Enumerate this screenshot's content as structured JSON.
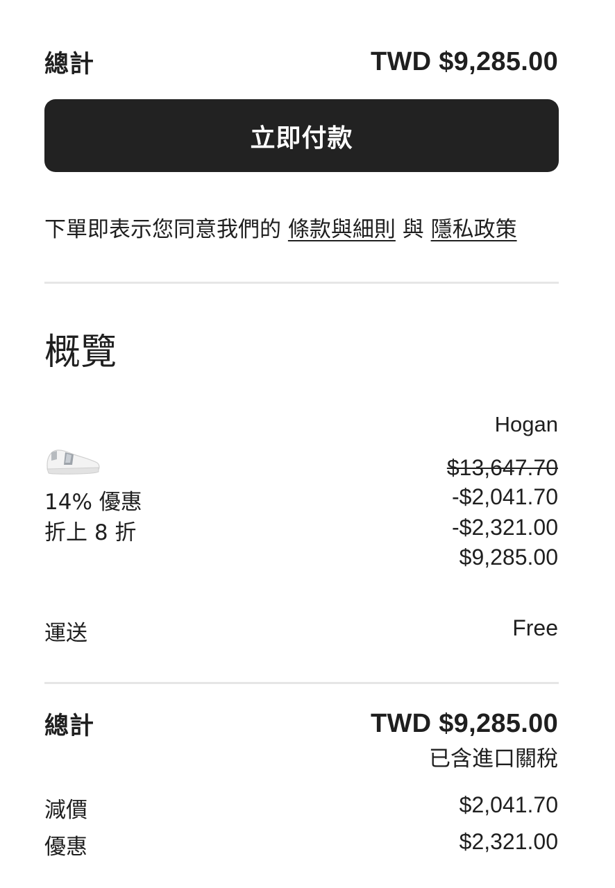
{
  "summary_top": {
    "label": "總計",
    "amount": "TWD $9,285.00"
  },
  "pay_button": {
    "label": "立即付款"
  },
  "consent": {
    "prefix": "下單即表示您同意我們的",
    "terms_link": "條款與細則",
    "joiner": "與",
    "privacy_link": "隱私政策"
  },
  "overview": {
    "title": "概覽",
    "product": {
      "brand": "Hogan",
      "image_icon": "sneaker-thumbnail",
      "original_price": "$13,647.70",
      "discount_label": "14% 優惠",
      "discount_amount": "-$2,041.70",
      "extra_discount_label": "折上 8 折",
      "extra_discount_amount": "-$2,321.00",
      "final_price": "$9,285.00"
    },
    "shipping": {
      "label": "運送",
      "value": "Free"
    }
  },
  "totals": {
    "label": "總計",
    "amount": "TWD $9,285.00",
    "tax_note": "已含進口關稅",
    "reduction_label": "減價",
    "reduction_value": "$2,041.70",
    "promo_label": "優惠",
    "promo_value": "$2,321.00"
  }
}
